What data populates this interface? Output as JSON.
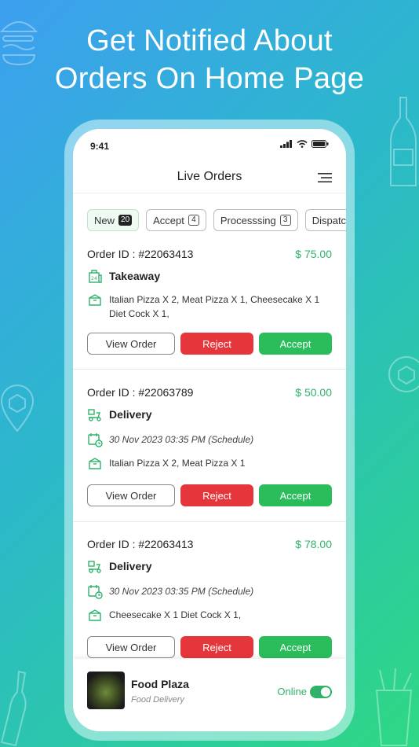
{
  "promo": {
    "headline_line1": "Get Notified About",
    "headline_line2": "Orders On Home Page"
  },
  "status_bar": {
    "time": "9:41"
  },
  "header": {
    "title": "Live Orders",
    "menu_icon": "hamburger-menu-icon"
  },
  "tabs": [
    {
      "label": "New",
      "count": "20",
      "active": true
    },
    {
      "label": "Accept",
      "count": "4",
      "active": false
    },
    {
      "label": "Processsing",
      "count": "3",
      "active": false
    },
    {
      "label": "Dispatch",
      "count": "",
      "active": false
    }
  ],
  "orders": [
    {
      "id_label": "Order ID :",
      "id": "#22063413",
      "price": "$ 75.00",
      "type": "Takeaway",
      "type_icon": "takeaway-bag-icon",
      "schedule": "",
      "items": "Italian Pizza X 2, Meat Pizza X 1, Cheesecake X 1 Diet Cock X 1,"
    },
    {
      "id_label": "Order ID :",
      "id": "#22063789",
      "price": "$ 50.00",
      "type": "Delivery",
      "type_icon": "delivery-scooter-icon",
      "schedule": "30 Nov 2023 03:35 PM (Schedule)",
      "items": "Italian Pizza X 2, Meat Pizza X 1"
    },
    {
      "id_label": "Order ID :",
      "id": "#22063413",
      "price": "$ 78.00",
      "type": "Delivery",
      "type_icon": "delivery-scooter-icon",
      "schedule": "30 Nov 2023 03:35 PM (Schedule)",
      "items": "Cheesecake X 1 Diet Cock X 1,"
    }
  ],
  "buttons": {
    "view": "View Order",
    "reject": "Reject",
    "accept": "Accept"
  },
  "restaurant": {
    "name": "Food Plaza",
    "subtitle": "Food Delivery",
    "status": "Online",
    "online": true
  },
  "colors": {
    "accent_green": "#2fb36a",
    "reject_red": "#e5363b",
    "accept_green": "#2bbd5c"
  }
}
